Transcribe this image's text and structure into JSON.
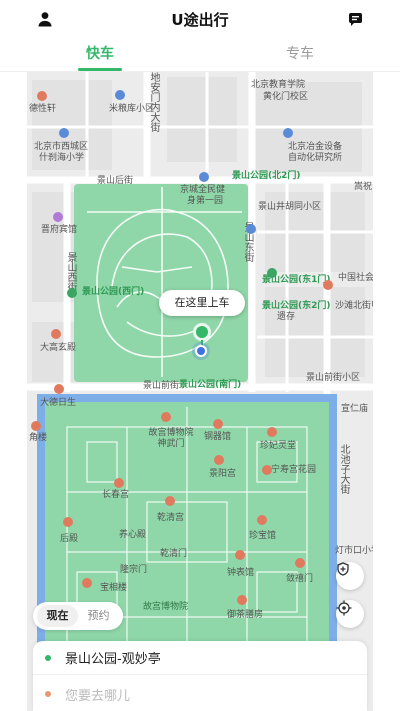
{
  "app": {
    "title": "U途出行"
  },
  "tabs": [
    {
      "label": "快车",
      "active": true
    },
    {
      "label": "专车",
      "active": false
    }
  ],
  "colors": {
    "accent": "#33b86a",
    "park": "#8fd7a8",
    "moat": "#7eaee8",
    "pin": "#33b86a",
    "location": "#3e72e0",
    "destination_dot": "#e69a73"
  },
  "icons": {
    "profile": "user-icon",
    "messages": "message-icon",
    "safety": "shield-plus-icon",
    "locate": "crosshair-icon"
  },
  "map": {
    "pickup_tooltip": "在这里上车",
    "labels": {
      "l1": "北京教育学院",
      "l2": "黄化门校区",
      "l3": "米粮库小区",
      "l4": "德性轩",
      "l5": "北京市西城区",
      "l6": "什刹海小学",
      "l7": "北京冶金设备",
      "l8": "自动化研究所",
      "l9": "景山公园(北2门)",
      "l10": "京城全民健",
      "l11": "身第一园",
      "l12": "景山后街",
      "l13": "景山井胡同小区",
      "l14": "嵩祝",
      "l15": "晋府宾馆",
      "l16": "景山公园(西门)",
      "l17": "景山公园(东1门)",
      "l18": "景山公园(东2门)",
      "l19": "中国社会科学院",
      "l20": "沙滩北街甲2号",
      "l21": "大高玄殿",
      "l22": "景山前街小区",
      "l23": "景山公园(南门)",
      "l24": "景山前街",
      "l25": "大德日生",
      "l26": "宣仁庙",
      "l27": "故宫博物院神武门",
      "l28": "钢器馆",
      "l29": "珍妃灵堂",
      "l30": "角楼",
      "l31": "景阳宫",
      "l32": "宁寿宫花园",
      "l33": "长春宫",
      "l34": "乾清宫",
      "l35": "养心殿",
      "l36": "乾清门",
      "l37": "珍宝馆",
      "l38": "后殿",
      "l39": "隆宗门",
      "l40": "钟表馆",
      "l41": "敛禧门",
      "l42": "宝相楼",
      "l43": "故宫博物院",
      "l44": "御茶膳房",
      "l45": "灯市口小学",
      "l46": "北池子大街",
      "l47": "地安门内大街",
      "l48": "景山东街",
      "l49": "景山西街",
      "l50": "遗存"
    }
  },
  "time_toggle": {
    "now": "现在",
    "reserve": "预约",
    "selected": "现在"
  },
  "route": {
    "pickup": "景山公园-观妙亭",
    "destination_placeholder": "您要去哪儿"
  }
}
